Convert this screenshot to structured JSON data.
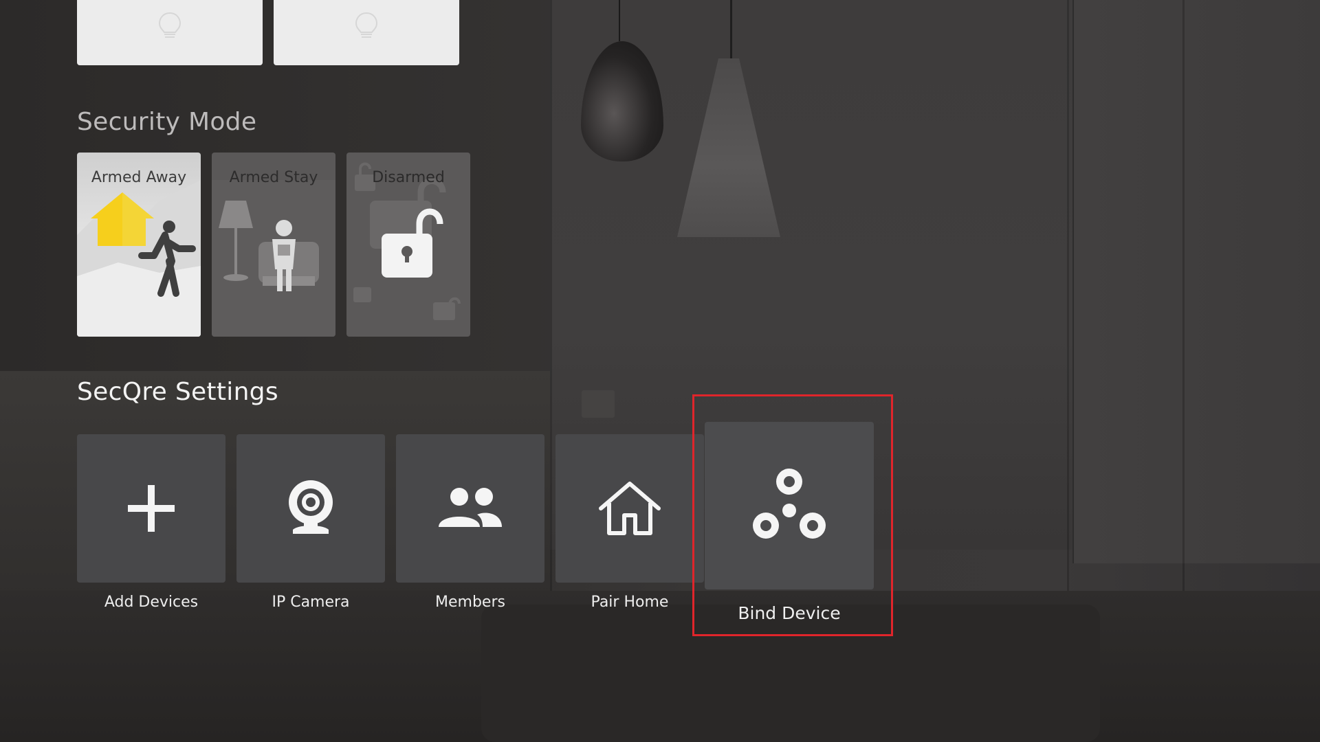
{
  "lights": [
    {
      "icon": "lightbulb-icon"
    },
    {
      "icon": "lightbulb-icon"
    }
  ],
  "security_mode": {
    "title": "Security Mode",
    "modes": [
      {
        "label": "Armed Away",
        "icon": "armed-away-icon",
        "selected": true
      },
      {
        "label": "Armed Stay",
        "icon": "armed-stay-icon",
        "selected": false
      },
      {
        "label": "Disarmed",
        "icon": "unlock-icon",
        "selected": false
      }
    ]
  },
  "settings": {
    "title": "SecQre Settings",
    "items": [
      {
        "label": "Add Devices",
        "icon": "plus-icon"
      },
      {
        "label": "IP Camera",
        "icon": "webcam-icon"
      },
      {
        "label": "Members",
        "icon": "people-icon"
      },
      {
        "label": "Pair Home",
        "icon": "home-icon"
      },
      {
        "label": "Bind Device",
        "icon": "bind-device-icon",
        "focused": true
      }
    ]
  },
  "colors": {
    "focus_outline": "#e0252b",
    "tile_background": "#48484a",
    "armed_away_house": "#f6cf1c"
  }
}
